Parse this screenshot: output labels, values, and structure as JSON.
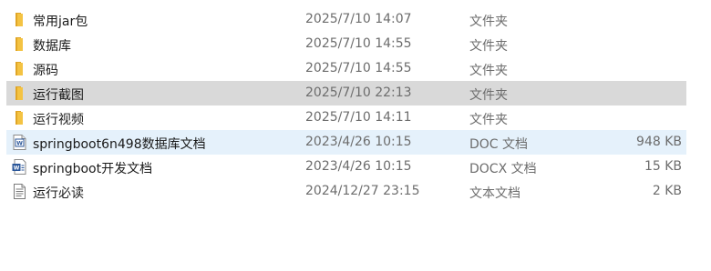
{
  "files": [
    {
      "name": "常用jar包",
      "date": "2025/7/10 14:07",
      "type": "文件夹",
      "size": "",
      "icon": "folder-icon"
    },
    {
      "name": "数据库",
      "date": "2025/7/10 14:55",
      "type": "文件夹",
      "size": "",
      "icon": "folder-icon"
    },
    {
      "name": "源码",
      "date": "2025/7/10 14:55",
      "type": "文件夹",
      "size": "",
      "icon": "folder-icon"
    },
    {
      "name": "运行截图",
      "date": "2025/7/10 22:13",
      "type": "文件夹",
      "size": "",
      "icon": "folder-icon",
      "state": "selected"
    },
    {
      "name": "运行视频",
      "date": "2025/7/10 14:11",
      "type": "文件夹",
      "size": "",
      "icon": "folder-icon"
    },
    {
      "name": "springboot6n498数据库文档",
      "date": "2023/4/26 10:15",
      "type": "DOC 文档",
      "size": "948 KB",
      "icon": "word-doc-icon",
      "state": "hover"
    },
    {
      "name": "springboot开发文档",
      "date": "2023/4/26 10:15",
      "type": "DOCX 文档",
      "size": "15 KB",
      "icon": "word-docx-icon"
    },
    {
      "name": "运行必读",
      "date": "2024/12/27 23:15",
      "type": "文本文档",
      "size": "2 KB",
      "icon": "text-file-icon"
    }
  ],
  "colors": {
    "folder_body": "#f4c343",
    "folder_tab": "#e0a526",
    "selected_row": "#d9d9d9",
    "hover_row": "#e5f1fb",
    "word_blue": "#2b579a"
  }
}
